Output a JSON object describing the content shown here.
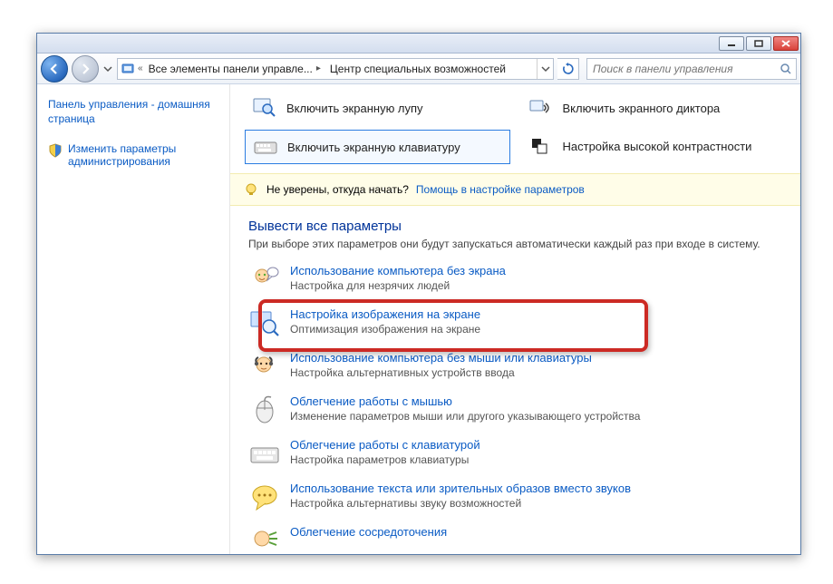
{
  "titlebar": {},
  "nav": {
    "crumb1": "Все элементы панели управле...",
    "crumb2": "Центр специальных возможностей",
    "search_placeholder": "Поиск в панели управления"
  },
  "sidebar": {
    "home": "Панель управления - домашняя страница",
    "admin": "Изменить параметры администрирования"
  },
  "quick": {
    "magnifier": "Включить экранную лупу",
    "osk": "Включить экранную клавиатуру",
    "narrator": "Включить экранного диктора",
    "contrast": "Настройка высокой контрастности"
  },
  "help": {
    "text": "Не уверены, откуда начать?",
    "link": "Помощь в настройке параметров"
  },
  "section": {
    "heading": "Вывести все параметры",
    "sub": "При выборе этих параметров они будут запускаться автоматически каждый раз при входе в систему."
  },
  "options": [
    {
      "title": "Использование компьютера без экрана",
      "desc": "Настройка для незрячих людей"
    },
    {
      "title": "Настройка изображения на экране",
      "desc": "Оптимизация изображения на экране"
    },
    {
      "title": "Использование компьютера без мыши или клавиатуры",
      "desc": "Настройка альтернативных устройств ввода"
    },
    {
      "title": "Облегчение работы с мышью",
      "desc": "Изменение параметров мыши или другого указывающего устройства"
    },
    {
      "title": "Облегчение работы с клавиатурой",
      "desc": "Настройка параметров клавиатуры"
    },
    {
      "title": "Использование текста или зрительных образов вместо звуков",
      "desc": "Настройка альтернативы звуку возможностей"
    },
    {
      "title": "Облегчение сосредоточения",
      "desc": ""
    }
  ]
}
